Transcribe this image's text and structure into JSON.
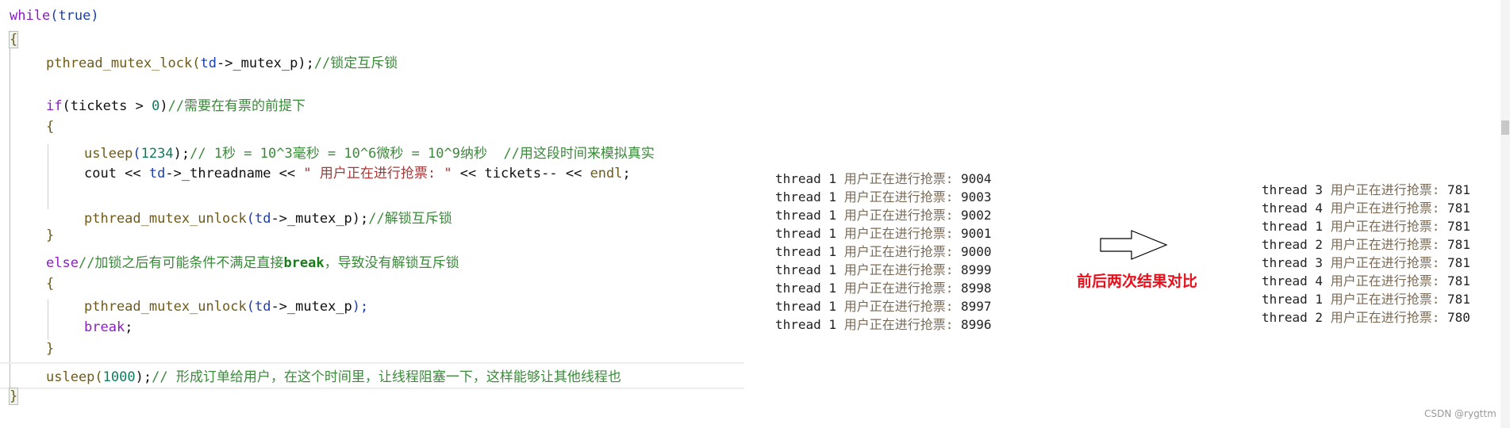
{
  "code": {
    "l1": [
      "while",
      "(",
      "true",
      ")"
    ],
    "l2": "{",
    "l3": [
      "pthread_mutex_lock",
      "(",
      "td",
      "->_mutex_p",
      ");",
      "//锁定互斥锁"
    ],
    "l4": [
      "if",
      "(tickets > ",
      "0",
      ")",
      "//需要在有票的前提下"
    ],
    "l5": "{",
    "l6": [
      "usleep",
      "(",
      "1234",
      ");",
      "// 1秒 = 10^3毫秒 = 10^6微秒 = 10^9纳秒  //用这段时间来模拟真实"
    ],
    "l7": [
      "cout << ",
      "td",
      "->_threadname << ",
      "\" 用户正在进行抢票: \"",
      " << tickets-- << ",
      "endl",
      ";"
    ],
    "l8": [
      "pthread_mutex_unlock",
      "(",
      "td",
      "->_mutex_p",
      ");",
      "//解锁互斥锁"
    ],
    "l9": "}",
    "l10": [
      "else",
      "//加锁之后有可能条件不满足直接",
      "break",
      "，导致没有解锁互斥锁"
    ],
    "l11": "{",
    "l12": [
      "pthread_mutex_unlock",
      "(",
      "td",
      "->_mutex_p",
      ");"
    ],
    "l13": [
      "break",
      ";"
    ],
    "l14": "}",
    "l15": [
      "usleep",
      "(",
      "1000",
      ");",
      "// 形成订单给用户，在这个时间里，让线程阻塞一下，这样能够让其他线程也"
    ],
    "l16": "}"
  },
  "console_before": [
    [
      "thread 1 ",
      "用户正在进行抢票: ",
      "9004"
    ],
    [
      "thread 1 ",
      "用户正在进行抢票: ",
      "9003"
    ],
    [
      "thread 1 ",
      "用户正在进行抢票: ",
      "9002"
    ],
    [
      "thread 1 ",
      "用户正在进行抢票: ",
      "9001"
    ],
    [
      "thread 1 ",
      "用户正在进行抢票: ",
      "9000"
    ],
    [
      "thread 1 ",
      "用户正在进行抢票: ",
      "8999"
    ],
    [
      "thread 1 ",
      "用户正在进行抢票: ",
      "8998"
    ],
    [
      "thread 1 ",
      "用户正在进行抢票: ",
      "8997"
    ],
    [
      "thread 1 ",
      "用户正在进行抢票: ",
      "8996"
    ]
  ],
  "console_after": [
    [
      "thread 3 ",
      "用户正在进行抢票: ",
      "781"
    ],
    [
      "thread 4 ",
      "用户正在进行抢票: ",
      "781"
    ],
    [
      "thread 1 ",
      "用户正在进行抢票: ",
      "781"
    ],
    [
      "thread 2 ",
      "用户正在进行抢票: ",
      "781"
    ],
    [
      "thread 3 ",
      "用户正在进行抢票: ",
      "781"
    ],
    [
      "thread 4 ",
      "用户正在进行抢票: ",
      "781"
    ],
    [
      "thread 1 ",
      "用户正在进行抢票: ",
      "781"
    ],
    [
      "thread 2 ",
      "用户正在进行抢票: ",
      "780"
    ]
  ],
  "annotation": {
    "label": "前后两次结果对比",
    "arrow_icon": "right-arrow-outline",
    "color": "#e8101c"
  },
  "watermark": "CSDN @rygttm"
}
